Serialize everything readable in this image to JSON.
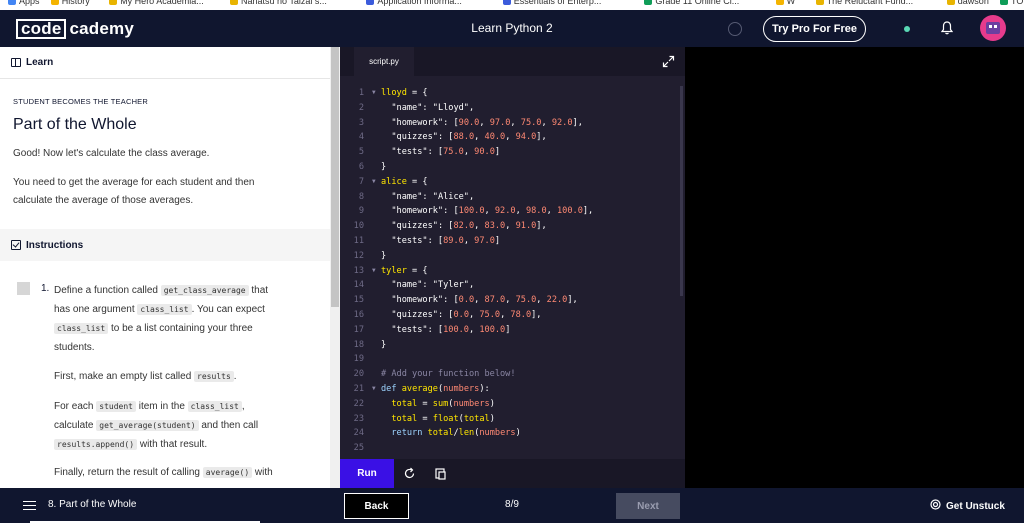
{
  "browser": {
    "bookmarks": [
      {
        "label": "Apps",
        "color": "#4285f4"
      },
      {
        "label": "History",
        "color": "#f4b400"
      },
      {
        "label": "My Hero Academia...",
        "color": "#e8b400"
      },
      {
        "label": "Nanatsu no Taizai s...",
        "color": "#e8b400"
      },
      {
        "label": "Application Informa...",
        "color": "#3b5bdb"
      },
      {
        "label": "Essentials of Enterp...",
        "color": "#3b5bdb"
      },
      {
        "label": "Grade 11 Online Cl...",
        "color": "#0f9d58"
      },
      {
        "label": "W",
        "color": "#f4b400"
      },
      {
        "label": "The Reluctant Fund...",
        "color": "#e8b400"
      },
      {
        "label": "dawson",
        "color": "#e8b400"
      },
      {
        "label": "TOK Presentation (...",
        "color": "#0f9d58"
      }
    ]
  },
  "header": {
    "logo_code": "code",
    "logo_cademy": "cademy",
    "course_title": "Learn Python 2",
    "try_pro_label": "Try Pro For Free",
    "accent": "#10162f",
    "status_color": "#5ad8b5"
  },
  "lesson": {
    "tab_label": "Learn",
    "kicker": "STUDENT BECOMES THE TEACHER",
    "title": "Part of the Whole",
    "para1": "Good! Now let's calculate the class average.",
    "para2_line1": "You need to get the average for each student and then",
    "para2_line2": "calculate the average of those averages.",
    "instructions_label": "Instructions",
    "task_number": "1.",
    "task": {
      "l1a": "Define a function called ",
      "l1code": "get_class_average",
      "l1b": " that",
      "l2a": "has one argument ",
      "l2code": "class_list",
      "l2b": ". You can expect",
      "l3code": "class_list",
      "l3b": " to be a list containing your three",
      "l4": "students.",
      "p2a": "First, make an empty list called ",
      "p2code": "results",
      "p2b": ".",
      "p3a": "For each ",
      "p3code1": "student",
      "p3b": " item in the ",
      "p3code2": "class_list",
      "p3c": ",",
      "p3d": "calculate ",
      "p3code3": "get_average(student)",
      "p3e": " and then call",
      "p3code4": "results.append()",
      "p3f": " with that result.",
      "p4a": "Finally, return the result of calling ",
      "p4code": "average()",
      "p4b": " with"
    }
  },
  "editor": {
    "file_tab": "script.py",
    "run_label": "Run",
    "colors": {
      "keyword": "#ffe600",
      "key": "#ffe083",
      "string": "#ffffff",
      "number": "#ff8973",
      "comment": "#8a86a4",
      "bracket": "#ffffff",
      "func": "#ffe600",
      "builtin": "#ff8973",
      "def": "#9dd4ff"
    },
    "lines": [
      {
        "n": "1",
        "fold": true,
        "parts": [
          [
            "k",
            "lloyd"
          ],
          [
            "p",
            " = {"
          ]
        ]
      },
      {
        "n": "2",
        "parts": [
          [
            "p",
            "  "
          ],
          [
            "s",
            "\"name\""
          ],
          [
            "p",
            ": "
          ],
          [
            "s",
            "\"Lloyd\""
          ],
          [
            "p",
            ","
          ]
        ]
      },
      {
        "n": "3",
        "parts": [
          [
            "p",
            "  "
          ],
          [
            "s",
            "\"homework\""
          ],
          [
            "p",
            ": ["
          ],
          [
            "num",
            "90.0"
          ],
          [
            "p",
            ", "
          ],
          [
            "num",
            "97.0"
          ],
          [
            "p",
            ", "
          ],
          [
            "num",
            "75.0"
          ],
          [
            "p",
            ", "
          ],
          [
            "num",
            "92.0"
          ],
          [
            "p",
            "],"
          ]
        ]
      },
      {
        "n": "4",
        "parts": [
          [
            "p",
            "  "
          ],
          [
            "s",
            "\"quizzes\""
          ],
          [
            "p",
            ": ["
          ],
          [
            "num",
            "88.0"
          ],
          [
            "p",
            ", "
          ],
          [
            "num",
            "40.0"
          ],
          [
            "p",
            ", "
          ],
          [
            "num",
            "94.0"
          ],
          [
            "p",
            "],"
          ]
        ]
      },
      {
        "n": "5",
        "parts": [
          [
            "p",
            "  "
          ],
          [
            "s",
            "\"tests\""
          ],
          [
            "p",
            ": ["
          ],
          [
            "num",
            "75.0"
          ],
          [
            "p",
            ", "
          ],
          [
            "num",
            "90.0"
          ],
          [
            "p",
            "]"
          ]
        ]
      },
      {
        "n": "6",
        "parts": [
          [
            "p",
            "}"
          ]
        ]
      },
      {
        "n": "7",
        "fold": true,
        "parts": [
          [
            "k",
            "alice"
          ],
          [
            "p",
            " = {"
          ]
        ]
      },
      {
        "n": "8",
        "parts": [
          [
            "p",
            "  "
          ],
          [
            "s",
            "\"name\""
          ],
          [
            "p",
            ": "
          ],
          [
            "s",
            "\"Alice\""
          ],
          [
            "p",
            ","
          ]
        ]
      },
      {
        "n": "9",
        "parts": [
          [
            "p",
            "  "
          ],
          [
            "s",
            "\"homework\""
          ],
          [
            "p",
            ": ["
          ],
          [
            "num",
            "100.0"
          ],
          [
            "p",
            ", "
          ],
          [
            "num",
            "92.0"
          ],
          [
            "p",
            ", "
          ],
          [
            "num",
            "98.0"
          ],
          [
            "p",
            ", "
          ],
          [
            "num",
            "100.0"
          ],
          [
            "p",
            "],"
          ]
        ]
      },
      {
        "n": "10",
        "parts": [
          [
            "p",
            "  "
          ],
          [
            "s",
            "\"quizzes\""
          ],
          [
            "p",
            ": ["
          ],
          [
            "num",
            "82.0"
          ],
          [
            "p",
            ", "
          ],
          [
            "num",
            "83.0"
          ],
          [
            "p",
            ", "
          ],
          [
            "num",
            "91.0"
          ],
          [
            "p",
            "],"
          ]
        ]
      },
      {
        "n": "11",
        "parts": [
          [
            "p",
            "  "
          ],
          [
            "s",
            "\"tests\""
          ],
          [
            "p",
            ": ["
          ],
          [
            "num",
            "89.0"
          ],
          [
            "p",
            ", "
          ],
          [
            "num",
            "97.0"
          ],
          [
            "p",
            "]"
          ]
        ]
      },
      {
        "n": "12",
        "parts": [
          [
            "p",
            "}"
          ]
        ]
      },
      {
        "n": "13",
        "fold": true,
        "parts": [
          [
            "k",
            "tyler"
          ],
          [
            "p",
            " = {"
          ]
        ]
      },
      {
        "n": "14",
        "parts": [
          [
            "p",
            "  "
          ],
          [
            "s",
            "\"name\""
          ],
          [
            "p",
            ": "
          ],
          [
            "s",
            "\"Tyler\""
          ],
          [
            "p",
            ","
          ]
        ]
      },
      {
        "n": "15",
        "parts": [
          [
            "p",
            "  "
          ],
          [
            "s",
            "\"homework\""
          ],
          [
            "p",
            ": ["
          ],
          [
            "num",
            "0.0"
          ],
          [
            "p",
            ", "
          ],
          [
            "num",
            "87.0"
          ],
          [
            "p",
            ", "
          ],
          [
            "num",
            "75.0"
          ],
          [
            "p",
            ", "
          ],
          [
            "num",
            "22.0"
          ],
          [
            "p",
            "],"
          ]
        ]
      },
      {
        "n": "16",
        "parts": [
          [
            "p",
            "  "
          ],
          [
            "s",
            "\"quizzes\""
          ],
          [
            "p",
            ": ["
          ],
          [
            "num",
            "0.0"
          ],
          [
            "p",
            ", "
          ],
          [
            "num",
            "75.0"
          ],
          [
            "p",
            ", "
          ],
          [
            "num",
            "78.0"
          ],
          [
            "p",
            "],"
          ]
        ]
      },
      {
        "n": "17",
        "parts": [
          [
            "p",
            "  "
          ],
          [
            "s",
            "\"tests\""
          ],
          [
            "p",
            ": ["
          ],
          [
            "num",
            "100.0"
          ],
          [
            "p",
            ", "
          ],
          [
            "num",
            "100.0"
          ],
          [
            "p",
            "]"
          ]
        ]
      },
      {
        "n": "18",
        "parts": [
          [
            "p",
            "}"
          ]
        ]
      },
      {
        "n": "19",
        "parts": []
      },
      {
        "n": "20",
        "parts": [
          [
            "c",
            "# Add your function below!"
          ]
        ]
      },
      {
        "n": "21",
        "fold": true,
        "parts": [
          [
            "d",
            "def"
          ],
          [
            "p",
            " "
          ],
          [
            "f",
            "average"
          ],
          [
            "p",
            "("
          ],
          [
            "num",
            "numbers"
          ],
          [
            "p",
            "):"
          ]
        ]
      },
      {
        "n": "22",
        "parts": [
          [
            "p",
            "  "
          ],
          [
            "k",
            "total"
          ],
          [
            "p",
            " = "
          ],
          [
            "f",
            "sum"
          ],
          [
            "p",
            "("
          ],
          [
            "num",
            "numbers"
          ],
          [
            "p",
            ")"
          ]
        ]
      },
      {
        "n": "23",
        "parts": [
          [
            "p",
            "  "
          ],
          [
            "k",
            "total"
          ],
          [
            "p",
            " = "
          ],
          [
            "f",
            "float"
          ],
          [
            "p",
            "("
          ],
          [
            "k",
            "total"
          ],
          [
            "p",
            ")"
          ]
        ]
      },
      {
        "n": "24",
        "parts": [
          [
            "p",
            "  "
          ],
          [
            "d",
            "return"
          ],
          [
            "p",
            " "
          ],
          [
            "k",
            "total"
          ],
          [
            "p",
            "/"
          ],
          [
            "f",
            "len"
          ],
          [
            "p",
            "("
          ],
          [
            "num",
            "numbers"
          ],
          [
            "p",
            ")"
          ]
        ]
      },
      {
        "n": "25",
        "parts": []
      }
    ]
  },
  "footer": {
    "lesson_crumb": "8. Part of the Whole",
    "back_label": "Back",
    "page_count": "8/9",
    "next_label": "Next",
    "unstuck_label": "Get Unstuck"
  }
}
